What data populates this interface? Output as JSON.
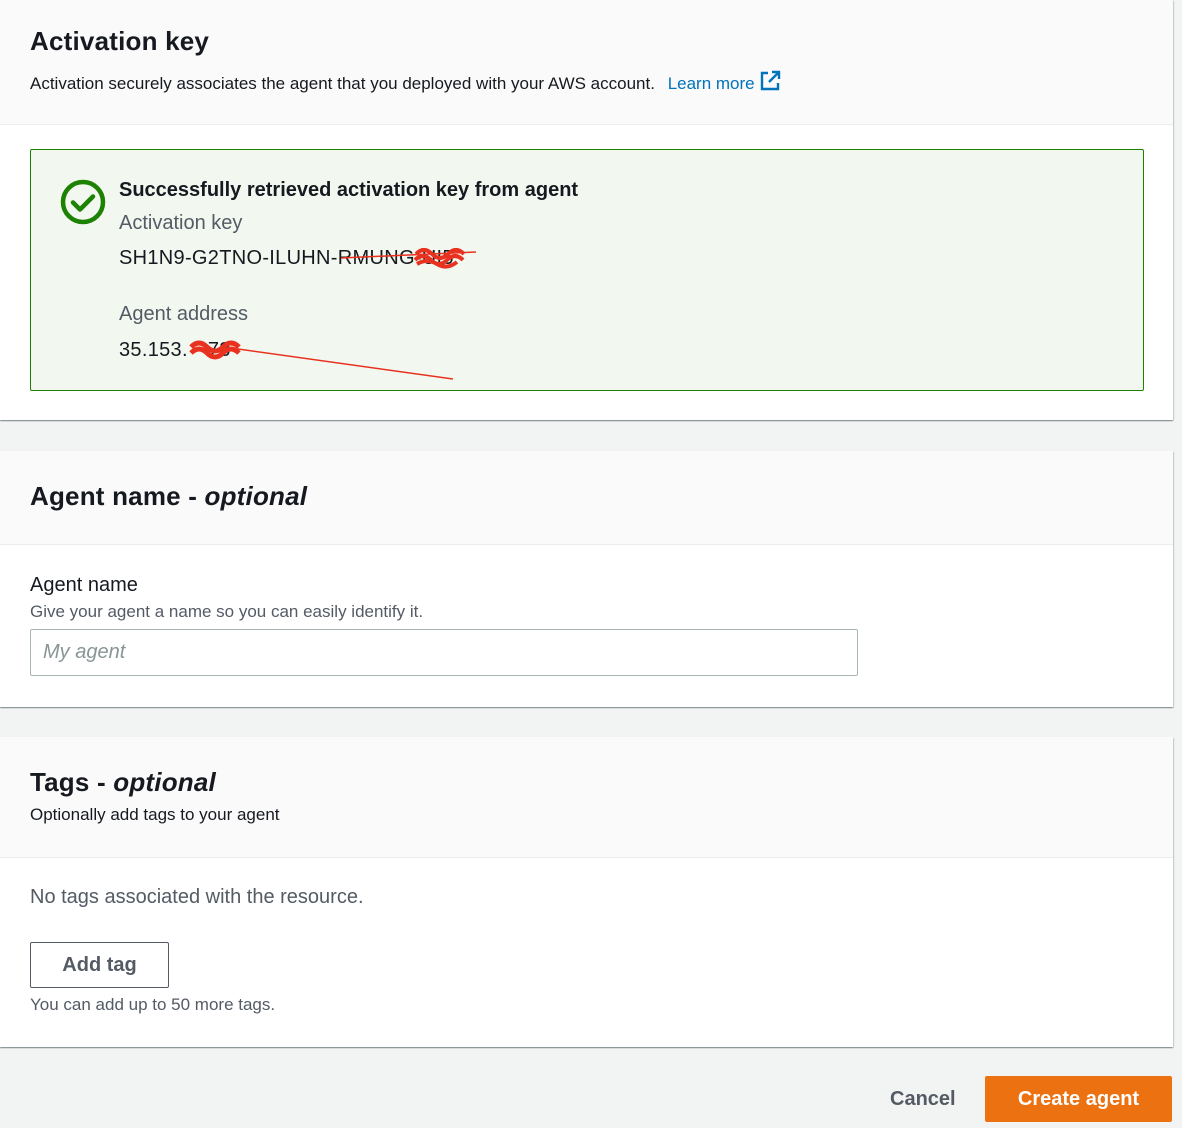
{
  "activation": {
    "title": "Activation key",
    "description": "Activation securely associates the agent that you deployed with your AWS account.",
    "learn_more": "Learn more",
    "alert": {
      "title": "Successfully retrieved activation key from agent",
      "key_label": "Activation key",
      "key_value": "SH1N9-G2TNO-ILUHN-RMUNG-",
      "key_tail": "UI5",
      "address_label": "Agent address",
      "address_value": "35.153.",
      "address_tail": "73"
    }
  },
  "agent_name": {
    "title": "Agent name - ",
    "title_optional": "optional",
    "field_label": "Agent name",
    "field_description": "Give your agent a name so you can easily identify it.",
    "placeholder": "My agent",
    "value": ""
  },
  "tags": {
    "title": "Tags - ",
    "title_optional": "optional",
    "description": "Optionally add tags to your agent",
    "empty_text": "No tags associated with the resource.",
    "add_button": "Add tag",
    "hint": "You can add up to 50 more tags."
  },
  "footer": {
    "cancel": "Cancel",
    "create": "Create agent"
  },
  "colors": {
    "accent": "#ec7211",
    "link": "#0073bb",
    "success": "#1d8102",
    "success_bg": "#f2f8f0",
    "redaction": "#e8321f"
  },
  "icons": [
    "external-link-icon",
    "success-check-icon"
  ]
}
